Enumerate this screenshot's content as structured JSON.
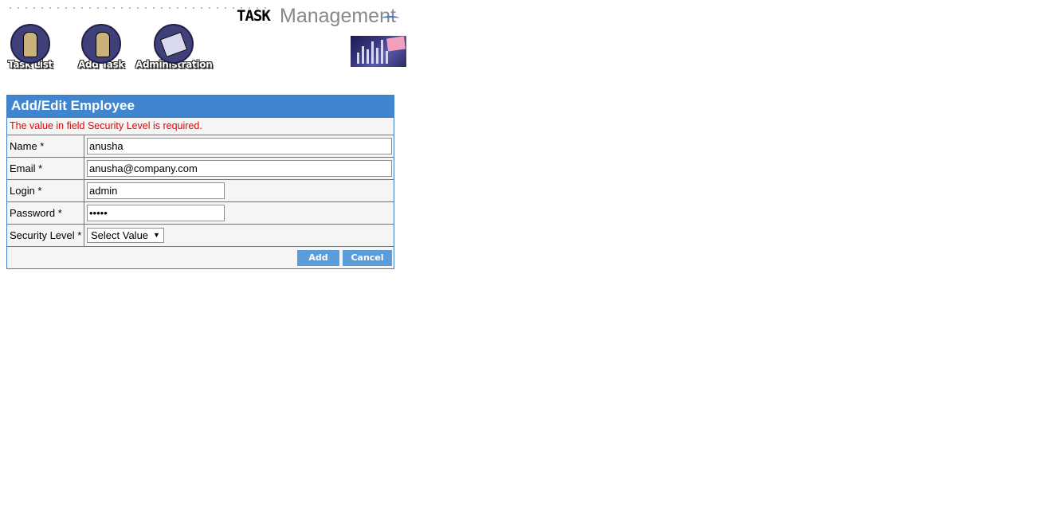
{
  "app": {
    "logo_task": "TASK",
    "logo_management": "Management"
  },
  "nav": {
    "items": [
      {
        "label": "Task List",
        "icon": "person-icon"
      },
      {
        "label": "Add Task",
        "icon": "person-computer-icon"
      },
      {
        "label": "Administration",
        "icon": "document-icon"
      }
    ]
  },
  "form": {
    "title": "Add/Edit Employee",
    "error": "The value in field Security Level is required.",
    "fields": {
      "name": {
        "label": "Name *",
        "value": "anusha"
      },
      "email": {
        "label": "Email *",
        "value": "anusha@company.com"
      },
      "login": {
        "label": "Login *",
        "value": "admin"
      },
      "password": {
        "label": "Password *",
        "value": "•••••"
      },
      "security_level": {
        "label": "Security Level *",
        "selected": "Select Value"
      }
    },
    "buttons": {
      "add": "Add",
      "cancel": "Cancel"
    }
  },
  "colors": {
    "header_blue": "#3f85d0",
    "button_blue": "#5b9ddb",
    "border_blue": "#3f7fc6",
    "error_red": "#ee0000"
  }
}
